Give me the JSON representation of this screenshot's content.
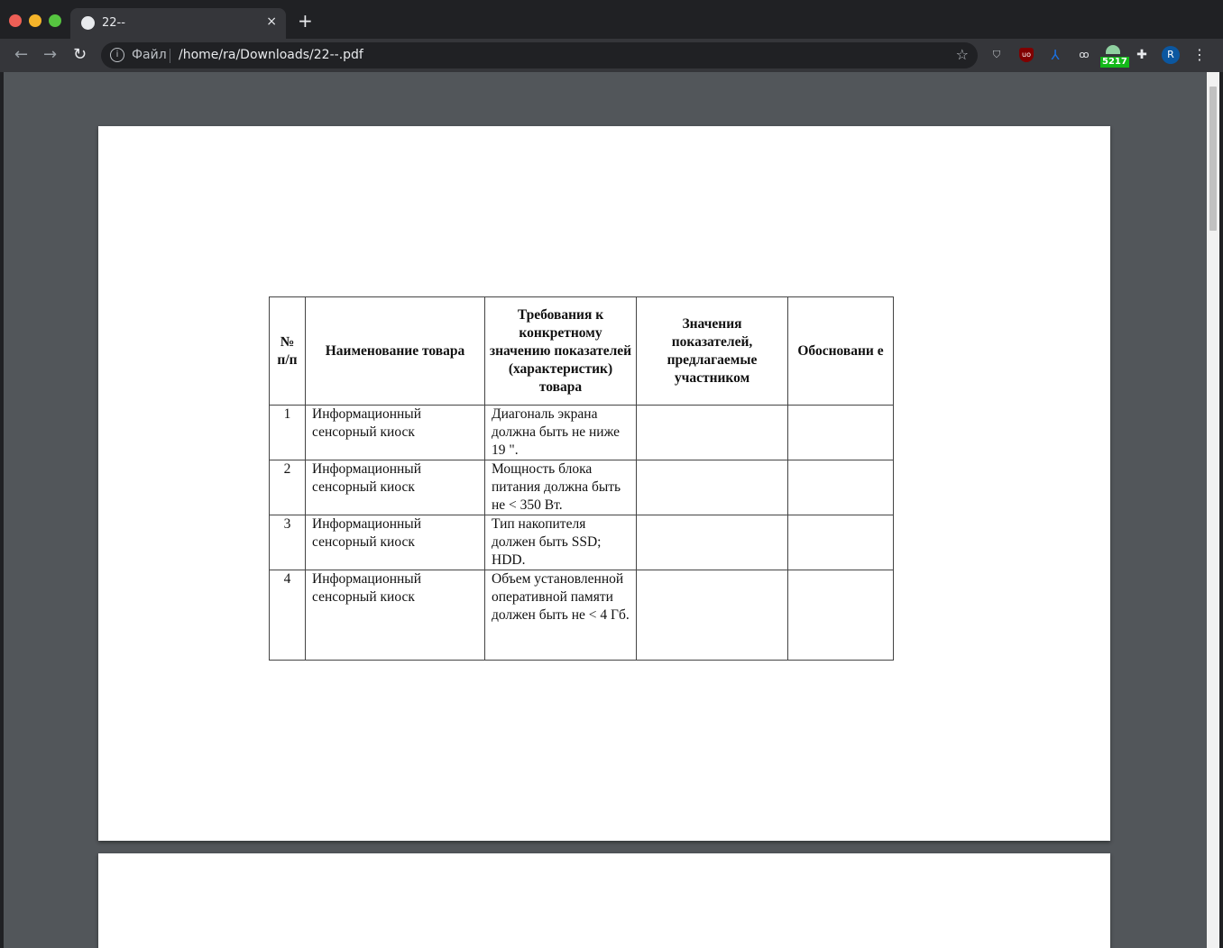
{
  "browser": {
    "tab_title": "22--",
    "close_icon": "×",
    "new_tab": "+",
    "back": "←",
    "forward": "→",
    "reload": "↻",
    "scheme_label": "Файл",
    "url": "/home/ra/Downloads/22--.pdf",
    "extensions": [
      {
        "name": "bitwarden",
        "glyph": "⛉",
        "color": "#bdc1c6"
      },
      {
        "name": "ublock",
        "glyph": "uo",
        "color": "#800000"
      },
      {
        "name": "acrobat",
        "glyph": "⅄",
        "color": "#1a73e8"
      },
      {
        "name": "privacy-badger",
        "glyph": "ꝏ",
        "color": "#e8eaed"
      },
      {
        "name": "counter",
        "glyph": "",
        "color": "#3ba541"
      },
      {
        "name": "puzzle",
        "glyph": "✚",
        "color": "#e8eaed"
      }
    ],
    "badge": "5217",
    "avatar": "R",
    "menu": "⋮"
  },
  "document": {
    "headers": [
      "№ п/п",
      "Наименование товара",
      "Требования к конкретному значению показателей (характеристик) товара",
      "Значения показателей, предлагаемые участником",
      "Обосновани е"
    ],
    "rows": [
      {
        "num": "1",
        "name": "Информационный сенсорный киоск",
        "req": "Диагональ экрана должна быть не ниже 19 \".",
        "value": "",
        "basis": ""
      },
      {
        "num": "2",
        "name": "Информационный сенсорный киоск",
        "req": "Мощность блока питания должна быть не < 350 Вт.",
        "value": "",
        "basis": ""
      },
      {
        "num": "3",
        "name": "Информационный сенсорный киоск",
        "req": "Тип накопителя должен быть SSD; HDD.",
        "value": "",
        "basis": ""
      },
      {
        "num": "4",
        "name": "Информационный сенсорный киоск",
        "req": "Объем установленной оперативной памяти должен быть не < 4 Гб.",
        "value": "",
        "basis": ""
      }
    ]
  }
}
